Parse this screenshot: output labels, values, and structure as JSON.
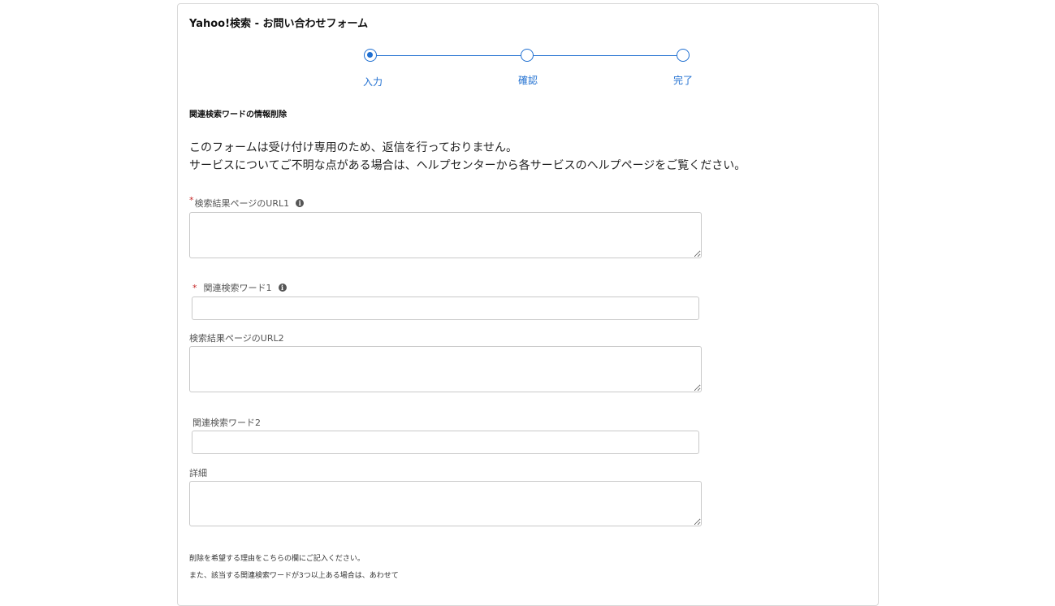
{
  "form": {
    "title": "Yahoo!検索 - お問い合わせフォーム",
    "steps": [
      {
        "label": "入力",
        "active": true
      },
      {
        "label": "確認",
        "active": false
      },
      {
        "label": "完了",
        "active": false
      }
    ],
    "section_heading": "関連検索ワードの情報削除",
    "intro": {
      "line1": "このフォームは受け付け専用のため、返信を行っておりません。",
      "line2": "サービスについてご不明な点がある場合は、ヘルプセンターから各サービスのヘルプページをご覧ください。"
    },
    "fields": {
      "url1": {
        "label": "検索結果ページのURL1",
        "required_mark": "*",
        "value": ""
      },
      "word1": {
        "label": "関連検索ワード1",
        "required_mark": "*",
        "value": ""
      },
      "url2": {
        "label": "検索結果ページのURL2",
        "value": ""
      },
      "word2": {
        "label": "関連検索ワード2",
        "value": ""
      },
      "details": {
        "label": "詳細",
        "value": ""
      }
    },
    "info_icon_glyph": "i",
    "notes": {
      "line1": "削除を希望する理由をこちらの欄にご記入ください。",
      "line2": "また、該当する関連検索ワードが3つ以上ある場合は、あわせて"
    }
  },
  "colors": {
    "accent": "#1f6fd1",
    "required": "#c62828",
    "border": "#c9c9c9"
  }
}
